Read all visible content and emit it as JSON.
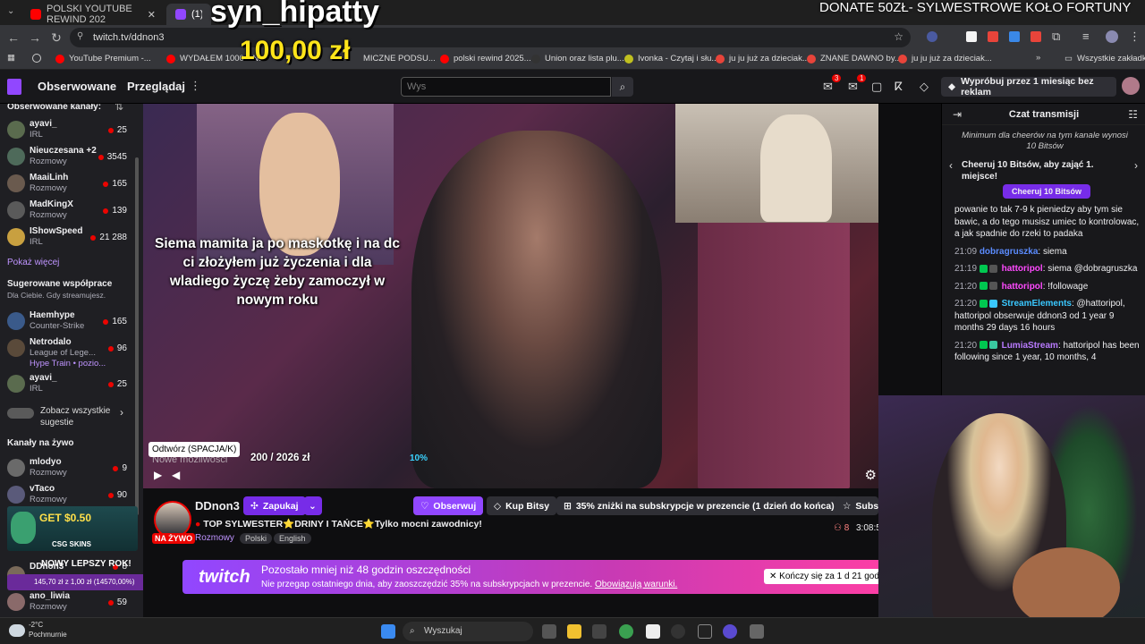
{
  "browser": {
    "tabs": [
      {
        "title": "POLSKI YOUTUBE REWIND 202",
        "color": "#ff0000"
      },
      {
        "title": "(1) DDnon3",
        "color": "#9147ff"
      }
    ],
    "url": "twitch.tv/ddnon3",
    "bookmarks": [
      {
        "label": "YouTube Premium -...",
        "color": "#ff0000"
      },
      {
        "label": "WYDAŁEM 1000zł N...",
        "color": "#ff0000"
      },
      {
        "label": "MICZNE PODSU...",
        "color": "#ff0000"
      },
      {
        "label": "polski rewind 2025...",
        "color": "#ff0000"
      },
      {
        "label": "Union oraz lista plu...",
        "color": "#333333"
      },
      {
        "label": "Ivonka - Czytaj i słu...",
        "color": "#c0c020"
      },
      {
        "label": "ju ju już za dzieciak...",
        "color": "#e8443a"
      },
      {
        "label": "ZNANE DAWNO by...",
        "color": "#e8443a"
      },
      {
        "label": "ju ju już za dzieciak...",
        "color": "#e8443a"
      },
      {
        "label": "Wszystkie zakładki",
        "color": "#888888"
      }
    ]
  },
  "twitch_nav": {
    "followed": "Obserwowane",
    "browse": "Przeglądaj",
    "search_placeholder": "Wys",
    "try_button": "Wypróbuj przez 1 miesiąc bez reklam",
    "notif_count_1": "3",
    "notif_count_2": "1"
  },
  "sidebar": {
    "followed_header": "Obserwowane kanały:",
    "followed": [
      {
        "name": "ayavi_",
        "game": "IRL",
        "viewers": "25"
      },
      {
        "name": "Nieuczesana +2",
        "game": "Rozmowy",
        "viewers": "3545"
      },
      {
        "name": "MaaiLinh",
        "game": "Rozmowy",
        "viewers": "165"
      },
      {
        "name": "MadKingX",
        "game": "Rozmowy",
        "viewers": "139"
      },
      {
        "name": "IShowSpeed",
        "game": "IRL",
        "viewers": "21 288"
      }
    ],
    "show_more": "Pokaż więcej",
    "suggested_header": "Sugerowane współprace",
    "suggested_sub": "Dla Ciebie. Gdy streamujesz.",
    "suggested": [
      {
        "name": "Haemhype",
        "game": "Counter-Strike",
        "viewers": "165"
      },
      {
        "name": "Netrodalo",
        "game": "League of Lege...",
        "viewers": "96"
      },
      {
        "name": "ayavi_",
        "game": "IRL",
        "viewers": "25"
      }
    ],
    "hype_train": "Hype Train • pozio...",
    "see_all": "Zobacz wszystkie sugestie",
    "live_header": "Kanały na żywo",
    "live": [
      {
        "name": "mlodyo",
        "game": "Rozmowy",
        "viewers": "9"
      },
      {
        "name": "vTaco",
        "game": "Rozmowy",
        "viewers": "90"
      },
      {
        "name": "DDnon3",
        "game": "",
        "viewers": "8"
      },
      {
        "name": "ano_liwia",
        "game": "Rozmowy",
        "viewers": "59"
      }
    ],
    "csgo_ad": {
      "get": "GET $0.50",
      "brand": "CSG SKINS"
    },
    "train_text": "145,70 zł z 1,00 zł (14570,00%)",
    "nowy": "NOWY LEPSZY ROK!"
  },
  "video": {
    "caption": "Siema mamita ja po maskotkę i na dc ci złożyłem już życzenia i dla wladiego życzę żeby zamoczył w nowym roku",
    "goal_label": "Nowe możliwości",
    "goal_text": "200 / 2026 zł",
    "goal_percent": "10%",
    "tooltip": "Odtwórz (SPACJA/K)"
  },
  "donation": {
    "donor": "syn_hipatty",
    "amount": "100,00 zł",
    "banner": "DONATE 50ZŁ- SYLWESTROWE KOŁO FORTUNY"
  },
  "stream_info": {
    "channel": "DDnon3",
    "live_badge": "NA ŻYWO",
    "gift_button": "Zapukaj",
    "follow_button": "Obserwuj",
    "bits_button": "Kup Bitsy",
    "sub_discount": "35% zniżki na subskrypcje w prezencie (1 dzień do końca)",
    "sub_button": "Subs",
    "title": "TOP SYLWESTER⭐DRINY I TAŃCE⭐Tylko mocni zawodnicy!",
    "category": "Rozmowy",
    "tags": [
      "Polski",
      "English"
    ],
    "viewers": "8",
    "uptime": "3:08:5"
  },
  "promo": {
    "logo": "twitch",
    "line1": "Pozostało mniej niż 48 godzin oszczędności",
    "line2": "Nie przegap ostatniego dnia, aby zaoszczędzić 35% na subskrypcjach w prezencie.",
    "terms": "Obowiązują warunki.",
    "ends": "Kończy się za 1 d 21 god"
  },
  "chat": {
    "header": "Czat transmisji",
    "cheer_min": "Minimum dla cheerów na tym kanale wynosi 10 Bitsów",
    "cheer_row": "Cheeruj 10 Bitsów, aby zająć 1. miejsce!",
    "cheer_button": "Cheeruj 10 Bitsów",
    "messages": [
      {
        "time": "",
        "user": "",
        "color": "#efeff1",
        "text": "powanie to tak 7-9 k pieniedzy aby tym sie bawic, a do tego musisz umiec to kontrolowac, a jak spadnie do rzeki to padaka"
      },
      {
        "time": "21:09",
        "user": "dobragruszka",
        "color": "#5b8cff",
        "text": "siema"
      },
      {
        "time": "21:19",
        "user": "hattoripol",
        "color": "#ff4aff",
        "text": "siema @dobragruszka"
      },
      {
        "time": "21:20",
        "user": "hattoripol",
        "color": "#ff4aff",
        "text": "!followage"
      },
      {
        "time": "21:20",
        "user": "StreamElements",
        "color": "#3ac8ff",
        "text": "@hattoripol, hattoripol obserwuje ddnon3 od 1 year 9 months 29 days 16 hours"
      },
      {
        "time": "21:20",
        "user": "LumiaStream",
        "color": "#b97bff",
        "text": "hattoripol has been following since 1 year, 10 months, 4"
      }
    ]
  },
  "taskbar": {
    "weather_temp": "-2°C",
    "weather_desc": "Pochmurnie",
    "search": "Wyszukaj"
  }
}
